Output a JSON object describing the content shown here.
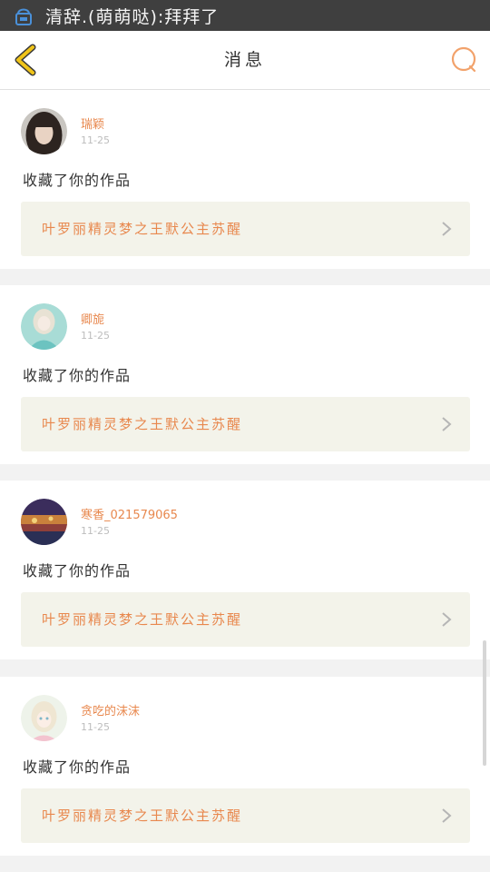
{
  "status_bar": {
    "notification": "清辞.(萌萌哒):拜拜了"
  },
  "header": {
    "title": "消息"
  },
  "colors": {
    "accent": "#e8884e",
    "back_icon": "#f0c419",
    "link_bg": "#f3f3ea"
  },
  "messages": [
    {
      "username": "瑞颖",
      "time": "11-25",
      "action": "收藏了你的作品",
      "work_title": "叶罗丽精灵梦之王默公主苏醒",
      "avatar_icon": "photo-avatar"
    },
    {
      "username": "卿旎",
      "time": "11-25",
      "action": "收藏了你的作品",
      "work_title": "叶罗丽精灵梦之王默公主苏醒",
      "avatar_icon": "anime-avatar"
    },
    {
      "username": "寒香_021579065",
      "time": "11-25",
      "action": "收藏了你的作品",
      "work_title": "叶罗丽精灵梦之王默公主苏醒",
      "avatar_icon": "landscape-avatar"
    },
    {
      "username": "贪吃的沫沫",
      "time": "11-25",
      "action": "收藏了你的作品",
      "work_title": "叶罗丽精灵梦之王默公主苏醒",
      "avatar_icon": "anime-girl-avatar"
    }
  ]
}
